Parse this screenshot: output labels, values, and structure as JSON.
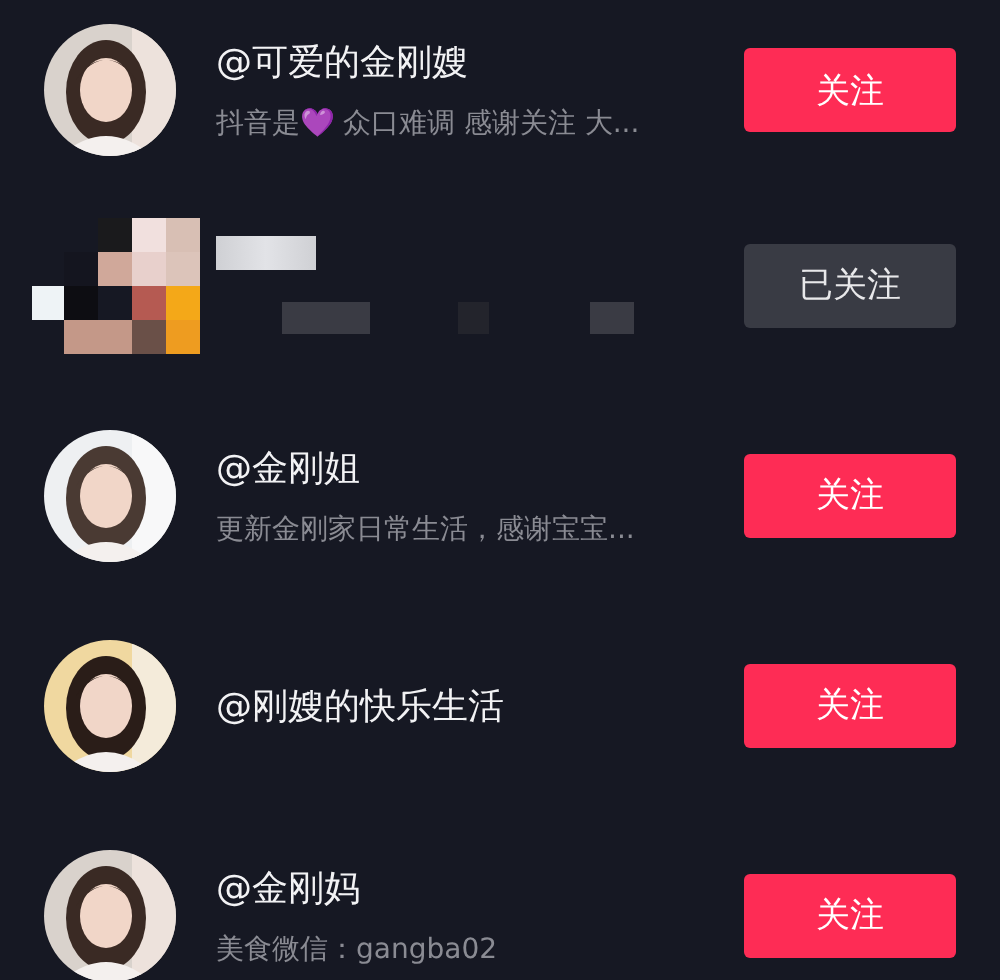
{
  "users": [
    {
      "kind": "profile",
      "name": "@可爱的金刚嫂",
      "bio": "抖音是💜 众口难调 感谢关注 大...",
      "button": "关注",
      "followed": false
    },
    {
      "kind": "pixelated",
      "button": "已关注",
      "followed": true
    },
    {
      "kind": "profile",
      "name": "@金刚姐",
      "bio": "更新金刚家日常生活，感谢宝宝...",
      "button": "关注",
      "followed": false
    },
    {
      "kind": "profile",
      "name": "@刚嫂的快乐生活",
      "button": "关注",
      "followed": false
    },
    {
      "kind": "profile",
      "name": "@金刚妈",
      "bio": "美食微信：gangba02",
      "button": "关注",
      "followed": false
    }
  ]
}
